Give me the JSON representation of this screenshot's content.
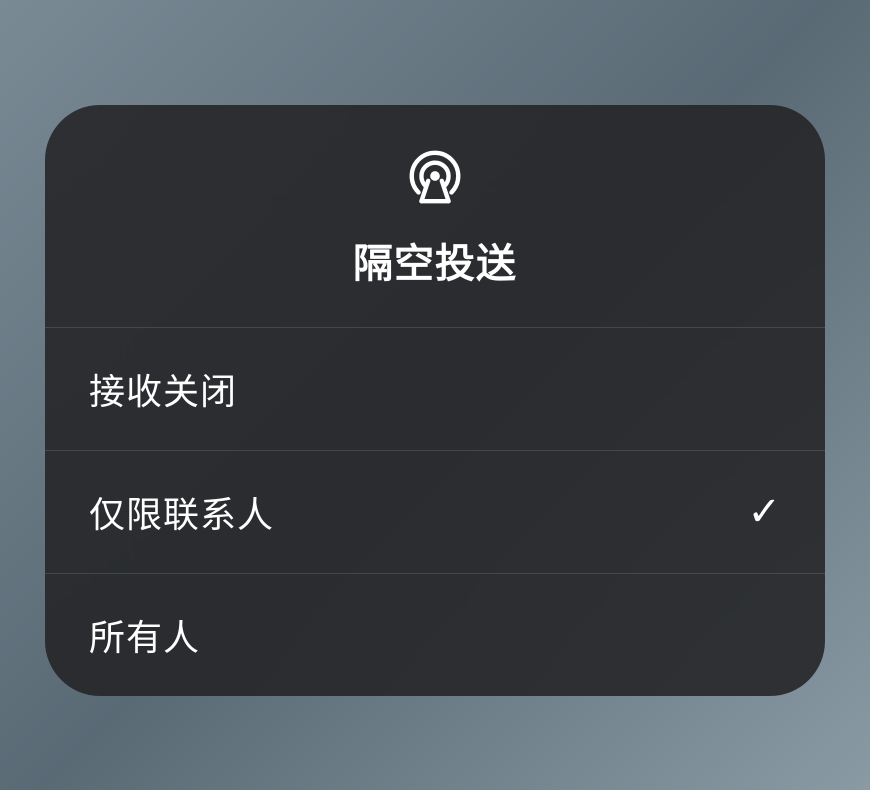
{
  "header": {
    "title": "隔空投送",
    "icon": "airdrop-icon"
  },
  "options": [
    {
      "label": "接收关闭",
      "selected": false
    },
    {
      "label": "仅限联系人",
      "selected": true
    },
    {
      "label": "所有人",
      "selected": false
    }
  ]
}
